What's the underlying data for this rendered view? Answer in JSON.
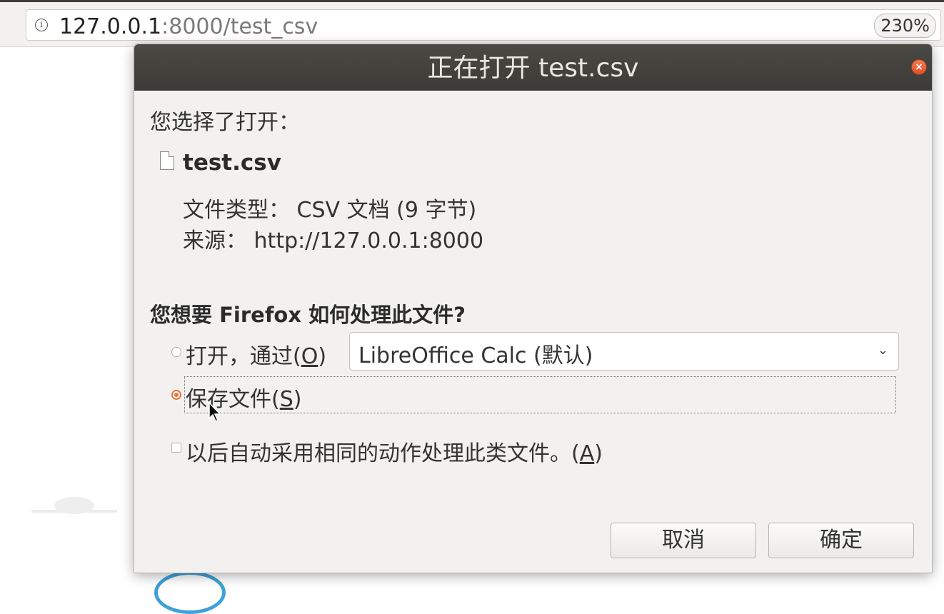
{
  "browser": {
    "url_host": "127.0.0.1",
    "url_rest": ":8000/test_csv",
    "zoom": "230%"
  },
  "dialog": {
    "title": "正在打开 test.csv",
    "intro": "您选择了打开：",
    "file_name": "test.csv",
    "file_type_label": "文件类型：",
    "file_type_value": "CSV 文档 (9 字节)",
    "source_label": "来源：",
    "source_value": "http://127.0.0.1:8000",
    "question": "您想要 Firefox 如何处理此文件?",
    "open_with": {
      "label_prefix": "打开，通过(",
      "mnemonic": "O",
      "label_suffix": ")",
      "selected": false,
      "app": "LibreOffice Calc (默认)"
    },
    "save_file": {
      "label_prefix": "保存文件(",
      "mnemonic": "S",
      "label_suffix": ")",
      "selected": true
    },
    "auto_action": {
      "label_prefix": "以后自动采用相同的动作处理此类文件。(",
      "mnemonic": "A",
      "label_suffix": ")",
      "checked": false
    },
    "cancel_label": "取消",
    "ok_label": "确定"
  },
  "colors": {
    "titlebar": "#3c3b37",
    "accent": "#e8743b",
    "dialog_bg": "#f2f1f0"
  }
}
